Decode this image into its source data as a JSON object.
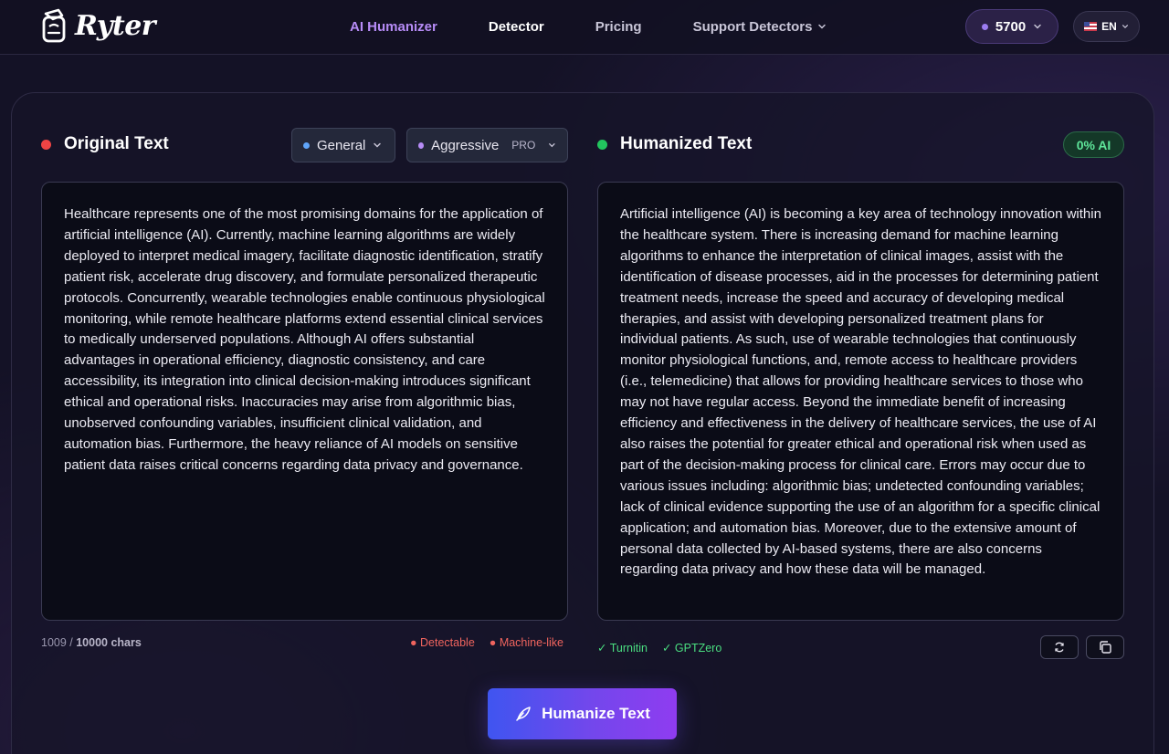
{
  "brand": {
    "name": "Ryter"
  },
  "nav": {
    "links": [
      {
        "label": "AI Humanizer"
      },
      {
        "label": "Detector"
      },
      {
        "label": "Pricing"
      },
      {
        "label": "Support Detectors"
      }
    ]
  },
  "credits": {
    "value": "5700",
    "icon": "credit-dot-icon"
  },
  "language": {
    "code": "EN",
    "icon": "us-flag-icon"
  },
  "original": {
    "title": "Original Text",
    "mode_select": "General",
    "strength_select": "Aggressive",
    "strength_badge": "PRO",
    "text": "Healthcare represents one of the most promising domains for the application of artificial intelligence (AI). Currently, machine learning algorithms are widely deployed to interpret medical imagery, facilitate diagnostic identification, stratify patient risk, accelerate drug discovery, and formulate personalized therapeutic protocols. Concurrently, wearable technologies enable continuous physiological monitoring, while remote healthcare platforms extend essential clinical services to medically underserved populations. Although AI offers substantial advantages in operational efficiency, diagnostic consistency, and care accessibility, its integration into clinical decision-making introduces significant ethical and operational risks. Inaccuracies may arise from algorithmic bias, unobserved confounding variables, insufficient clinical validation, and automation bias. Furthermore, the heavy reliance of AI models on sensitive patient data raises critical concerns regarding data privacy and governance.",
    "char_count": "1009",
    "char_sep": " / ",
    "char_limit": "10000 chars",
    "tags": [
      "● Detectable",
      "● Machine-like"
    ]
  },
  "humanized": {
    "title": "Humanized Text",
    "ai_score": "0% AI",
    "text": "Artificial intelligence (AI) is becoming a key area of technology innovation within the healthcare system. There is increasing demand for machine learning algorithms to enhance the interpretation of clinical images, assist with the identification of disease processes, aid in the processes for determining patient treatment needs, increase the speed and accuracy of developing medical therapies, and assist with developing personalized treatment plans for individual patients. As such, use of wearable technologies that continuously monitor physiological functions, and, remote access to healthcare providers (i.e., telemedicine) that allows for providing healthcare services to those who may not have regular access. Beyond the immediate benefit of increasing efficiency and effectiveness in the delivery of healthcare services, the use of AI also raises the potential for greater ethical and operational risk when used as part of the decision-making process for clinical care. Errors may occur due to various issues including: algorithmic bias; undetected confounding variables; lack of clinical evidence supporting the use of an algorithm for a specific clinical application; and automation bias. Moreover, due to the extensive amount of personal data collected by AI-based systems, there are also concerns regarding data privacy and how these data will be managed.",
    "passes": [
      "✓ Turnitin",
      "✓ GPTZero"
    ]
  },
  "action": {
    "label": "Humanize Text"
  },
  "colors": {
    "accent": "#b78cf7",
    "danger": "#ef4444",
    "success": "#22c55e",
    "tag_danger": "#f0645e",
    "tag_success": "#4ade80"
  }
}
